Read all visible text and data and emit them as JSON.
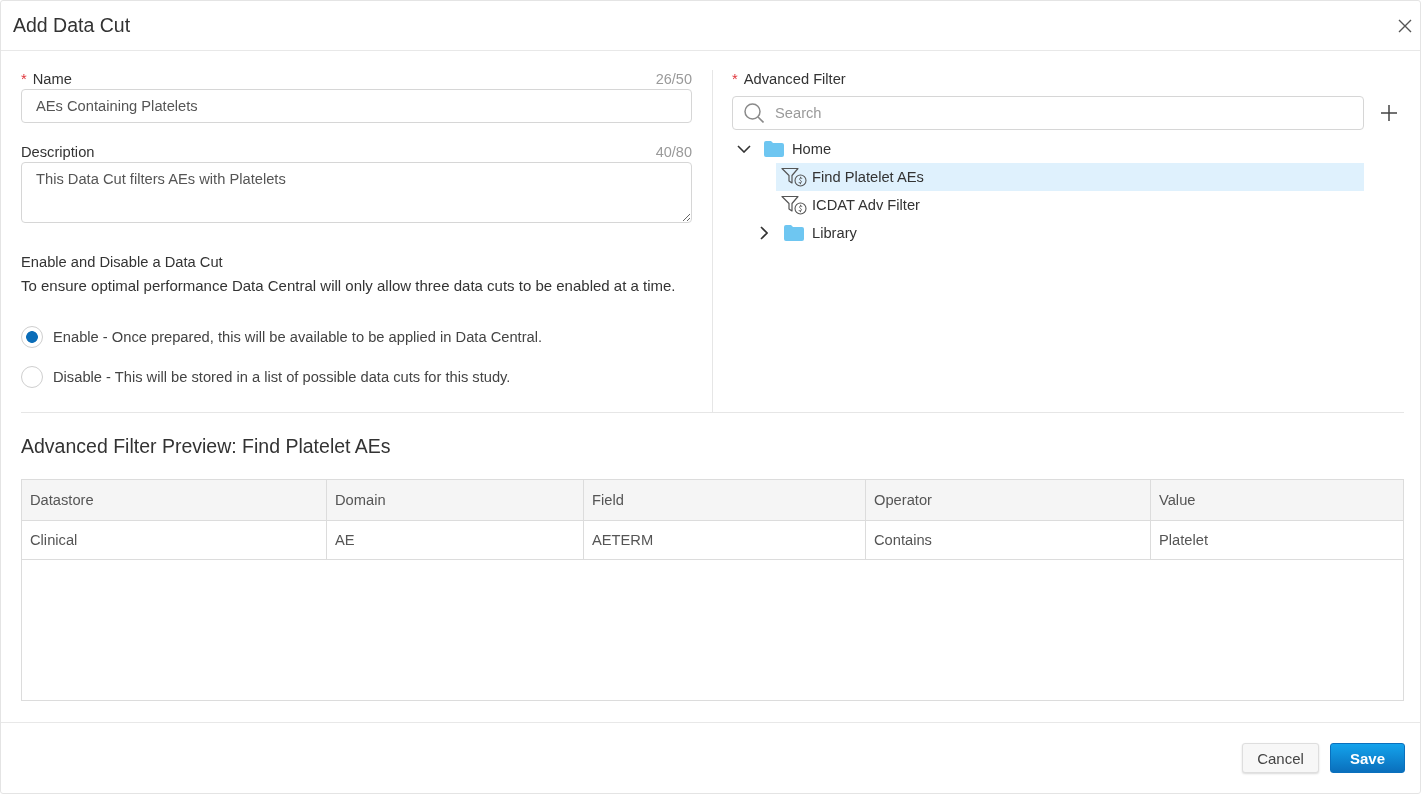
{
  "dialog": {
    "title": "Add Data Cut"
  },
  "fields": [
    {
      "kind": "input",
      "required_mark": "*",
      "label": "Name",
      "counter": "26/50",
      "value": "AEs Containing Platelets"
    },
    {
      "kind": "textarea",
      "label": "Description",
      "counter": "40/80",
      "value": "This Data Cut filters AEs with Platelets"
    }
  ],
  "enable_section": {
    "heading": "Enable and Disable a Data Cut",
    "note": "To ensure optimal performance Data Central will only allow three data cuts to be enabled at a time.",
    "options": [
      {
        "label": "Enable - Once prepared, this will be available to be applied in Data Central.",
        "selected": true
      },
      {
        "label": "Disable - This will be stored in a list of possible data cuts for this study.",
        "selected": false
      }
    ]
  },
  "advanced_filter": {
    "required_mark": "*",
    "label": "Advanced Filter",
    "search": {
      "placeholder": "Search"
    },
    "tree": [
      {
        "kind": "folder",
        "label": "Home",
        "expanded": true,
        "selected": false,
        "children": [
          {
            "kind": "filter",
            "label": "Find Platelet AEs",
            "selected": true
          },
          {
            "kind": "filter",
            "label": "ICDAT Adv Filter",
            "selected": false
          },
          {
            "kind": "folder",
            "label": "Library",
            "expanded": false,
            "selected": false
          }
        ]
      }
    ]
  },
  "preview": {
    "title": "Advanced Filter Preview: Find Platelet AEs",
    "table": {
      "columns": [
        "Datastore",
        "Domain",
        "Field",
        "Operator",
        "Value"
      ],
      "rows": [
        [
          "Clinical",
          "AE",
          "AETERM",
          "Contains",
          "Platelet"
        ]
      ]
    }
  },
  "footer": {
    "buttons": [
      {
        "kind": "secondary",
        "label": "Cancel"
      },
      {
        "kind": "primary",
        "label": "Save"
      }
    ]
  }
}
